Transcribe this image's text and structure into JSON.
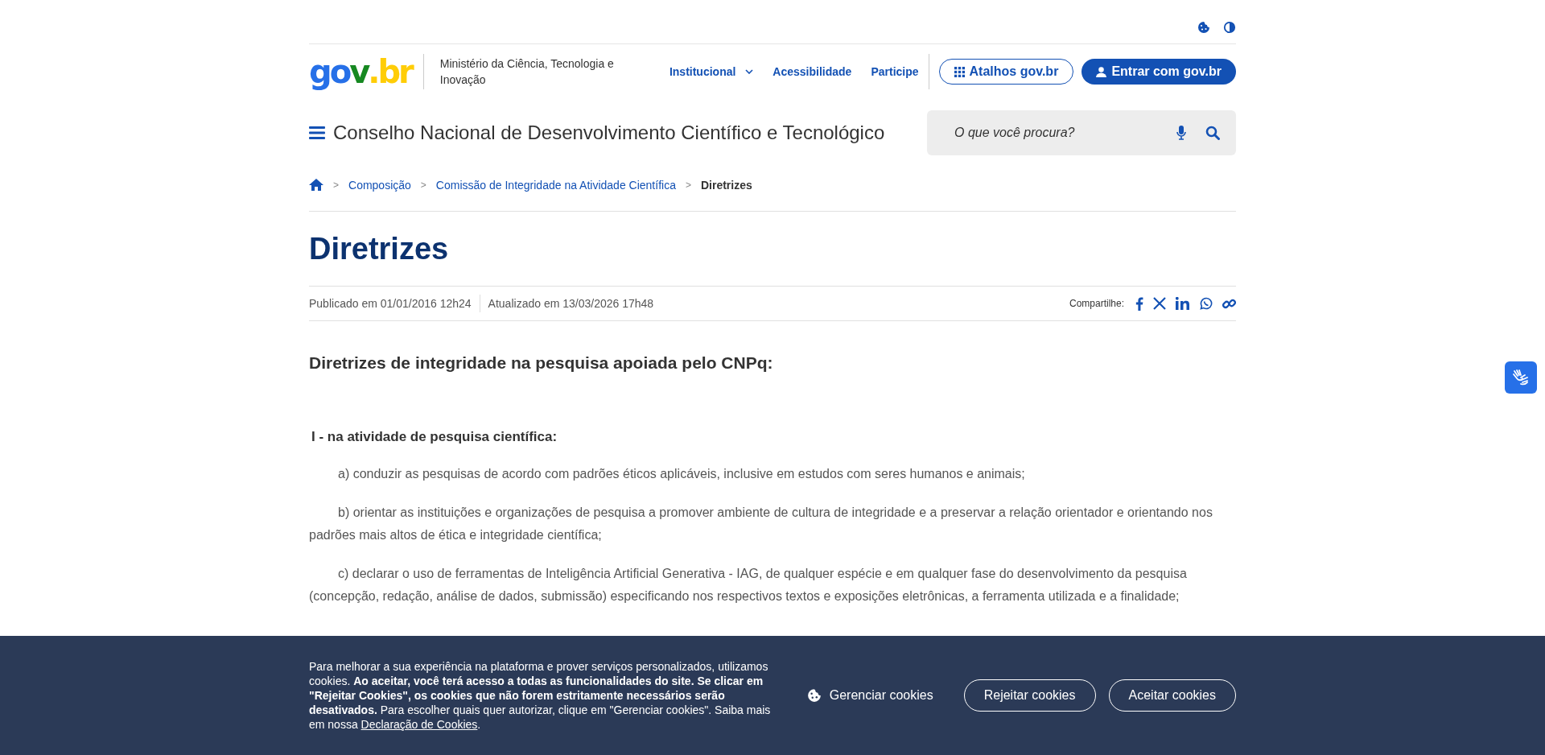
{
  "header": {
    "logo": "gov.br",
    "org": "Ministério da Ciência, Tecnologia e Inovação",
    "nav": [
      {
        "label": "Institucional",
        "dropdown": true
      },
      {
        "label": "Acessibilidade",
        "dropdown": false
      },
      {
        "label": "Participe",
        "dropdown": false
      }
    ],
    "shortcuts_button": "Atalhos gov.br",
    "login_button": "Entrar com gov.br",
    "site_title": "Conselho Nacional de Desenvolvimento Científico e Tecnológico",
    "search": {
      "placeholder": "O que você procura?"
    }
  },
  "breadcrumb": [
    {
      "label": "Composição",
      "current": false
    },
    {
      "label": "Comissão de Integridade na Atividade Científica",
      "current": false
    },
    {
      "label": "Diretrizes",
      "current": true
    }
  ],
  "breadcrumb_separator": ">",
  "page_title": "Diretrizes",
  "published": "Publicado em 01/01/2016 12h24",
  "updated": "Atualizado em 13/03/2026 17h48",
  "share_label": "Compartilhe:",
  "content": [
    {
      "kind": "heading",
      "text": "Diretrizes de integridade na pesquisa apoiada pelo CNPq:"
    },
    {
      "kind": "subheading",
      "text": "I - na atividade de pesquisa científica:"
    },
    {
      "kind": "item",
      "text": "a) conduzir as pesquisas de acordo com padrões éticos aplicáveis, inclusive em estudos com seres humanos e animais;"
    },
    {
      "kind": "item",
      "text": "b) orientar as instituições e organizações de pesquisa a promover ambiente de cultura de integridade e a preservar a relação orientador e orientando nos padrões mais altos de ética e integridade científica;"
    },
    {
      "kind": "item",
      "text": "c) declarar o uso de ferramentas de Inteligência Artificial Generativa - IAG, de qualquer espécie e em qualquer fase do desenvolvimento da pesquisa (concepção, redação, análise de dados, submissão) especificando nos respectivos textos e exposições eletrônicas, a ferramenta utilizada e a finalidade;"
    }
  ],
  "cookie_banner": {
    "text": "Para melhorar a sua experiência na plataforma e prover serviços personalizados, utilizamos cookies. **Ao aceitar, você terá acesso a todas as funcionalidades do site. Se clicar em \"Rejeitar Cookies\", os cookies que não forem estritamente necessários serão desativados.** Para escolher quais quer autorizar, clique em \"Gerenciar cookies\". Saiba mais em nossa ",
    "link": "Declaração de Cookies",
    "suffix": ".",
    "buttons": [
      {
        "label": "Gerenciar cookies",
        "kind": "manage"
      },
      {
        "label": "Rejeitar cookies",
        "kind": "outline"
      },
      {
        "label": "Aceitar cookies",
        "kind": "outline"
      }
    ]
  }
}
